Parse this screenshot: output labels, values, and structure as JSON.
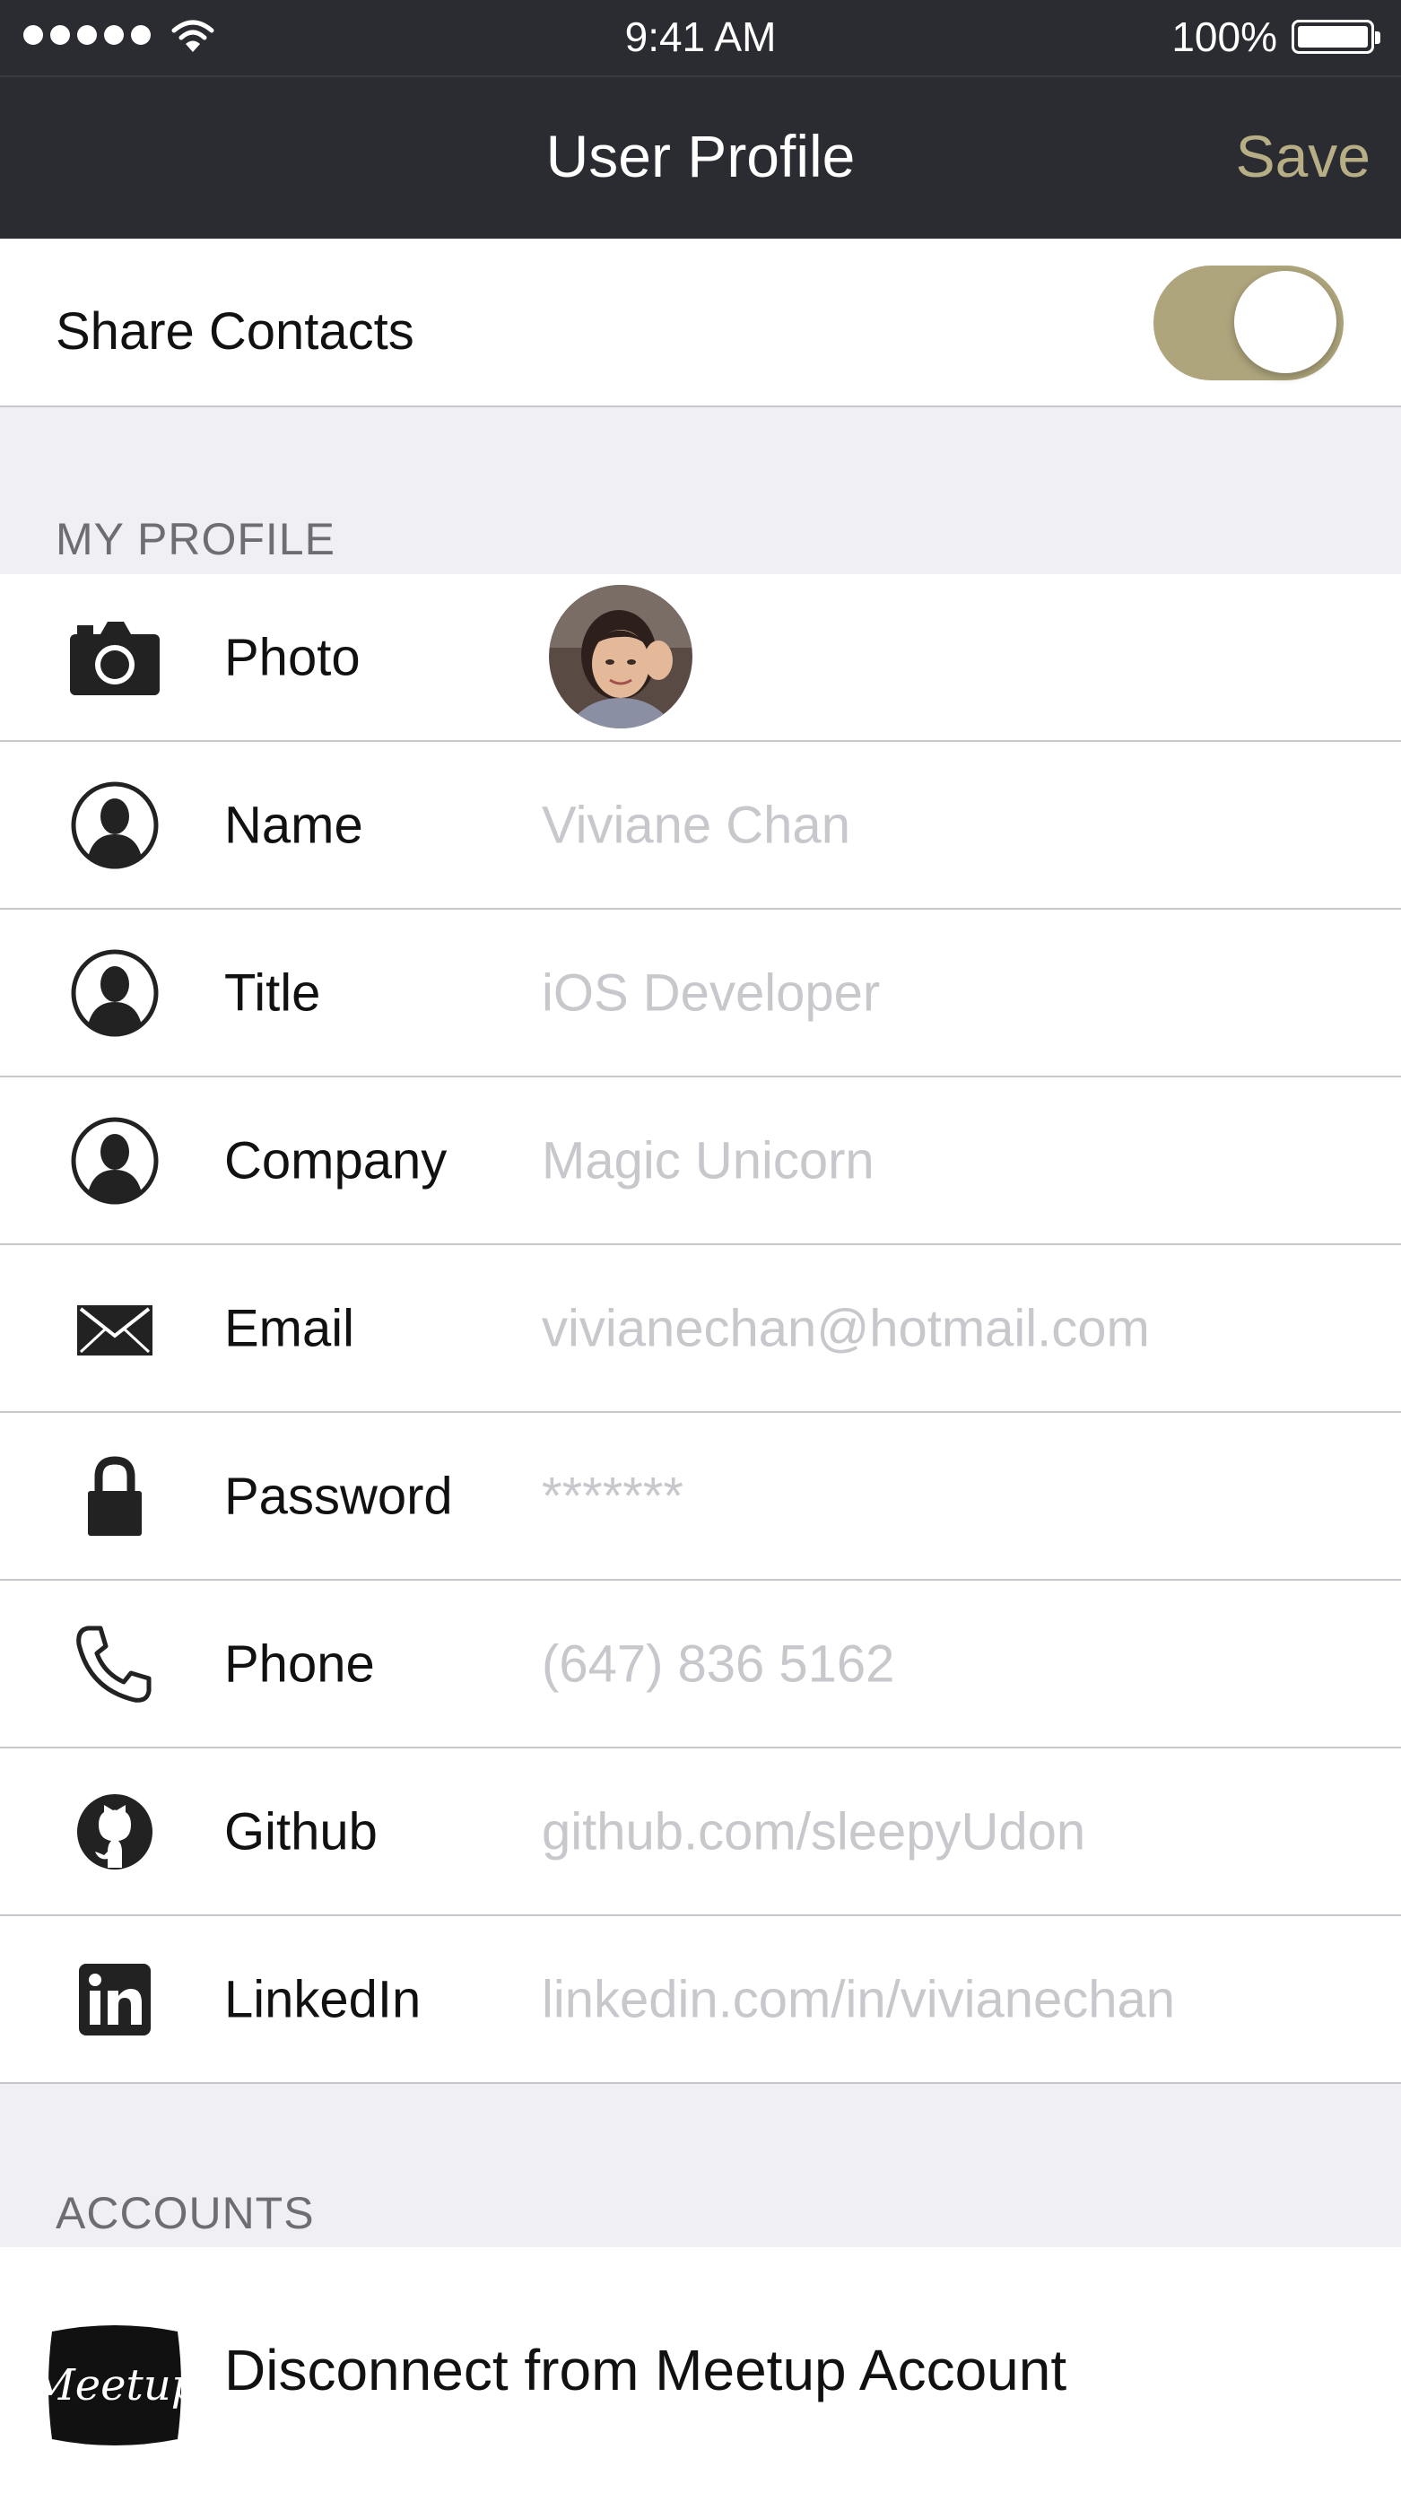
{
  "status_bar": {
    "time": "9:41 AM",
    "battery": "100%",
    "signal_icon": "signal-dots-icon",
    "wifi_icon": "wifi-icon",
    "battery_icon": "battery-icon"
  },
  "nav": {
    "title": "User Profile",
    "save_label": "Save"
  },
  "share": {
    "label": "Share Contacts",
    "enabled": true,
    "toggle_color": "#aea57c"
  },
  "profile_section": {
    "header": "MY PROFILE",
    "rows": [
      {
        "label": "Photo",
        "icon": "camera-icon",
        "value": ""
      },
      {
        "label": "Name",
        "icon": "person-icon",
        "value": "Viviane Chan"
      },
      {
        "label": "Title",
        "icon": "person-icon",
        "value": "iOS Developer"
      },
      {
        "label": "Company",
        "icon": "person-icon",
        "value": "Magic Unicorn"
      },
      {
        "label": "Email",
        "icon": "envelope-icon",
        "value": "vivianechan@hotmail.com"
      },
      {
        "label": "Password",
        "icon": "lock-icon",
        "value": "*******"
      },
      {
        "label": "Phone",
        "icon": "phone-icon",
        "value": "(647) 836 5162"
      },
      {
        "label": "Github",
        "icon": "github-icon",
        "value": "github.com/sleepyUdon"
      },
      {
        "label": "LinkedIn",
        "icon": "linkedin-icon",
        "value": "linkedin.com/in/vivianechan"
      }
    ]
  },
  "accounts_section": {
    "header": "ACCOUNTS",
    "item_label": "Disconnect from Meetup Account",
    "item_logo_text": "Meetup",
    "item_icon": "meetup-logo-icon"
  },
  "colors": {
    "nav_background": "#2b2c31",
    "accent": "#b7ae86",
    "placeholder_text": "#c7c7cc",
    "group_background": "#efeff4"
  }
}
